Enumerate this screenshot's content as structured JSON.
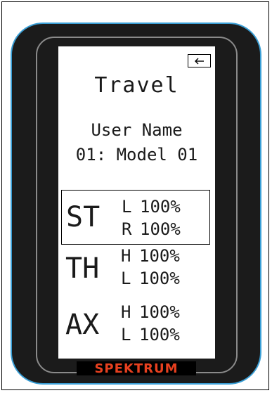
{
  "screen": {
    "back_icon": "back-arrow-icon",
    "title": "Travel",
    "user_name": "User Name",
    "model_name": "01: Model 01",
    "channels": [
      {
        "label": "ST",
        "selected": true,
        "rows": [
          {
            "side": "L",
            "value": "100%"
          },
          {
            "side": "R",
            "value": "100%"
          }
        ]
      },
      {
        "label": "TH",
        "selected": false,
        "rows": [
          {
            "side": "H",
            "value": "100%"
          },
          {
            "side": "L",
            "value": "100%"
          }
        ]
      },
      {
        "label": "AX",
        "selected": false,
        "rows": [
          {
            "side": "H",
            "value": "100%"
          },
          {
            "side": "L",
            "value": "100%"
          }
        ]
      }
    ]
  },
  "brand": {
    "name": "SPEKTRUM",
    "color": "#e8401f"
  },
  "colors": {
    "bezel_border": "#3a9fd6",
    "bezel": "#1b1b1b",
    "screen": "#ffffff"
  }
}
